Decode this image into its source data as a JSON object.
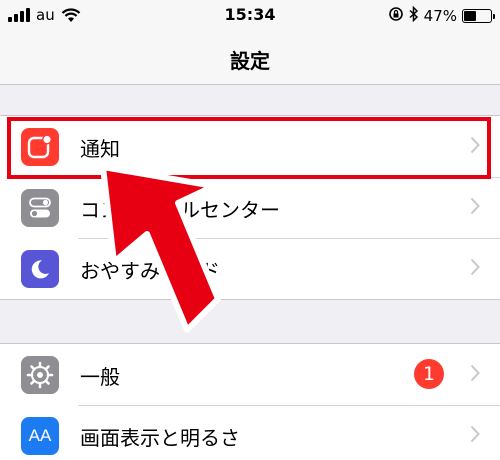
{
  "status_bar": {
    "carrier": "au",
    "time": "15:34",
    "battery_percent": "47%",
    "battery_level": 0.47
  },
  "nav": {
    "title": "設定"
  },
  "groups": [
    {
      "rows": [
        {
          "label": "通知",
          "icon": "notifications-icon",
          "icon_color": "#ff3b30"
        },
        {
          "label": "コントロールセンター",
          "icon": "control-center-icon",
          "icon_color": "#8e8e93"
        },
        {
          "label": "おやすみモード",
          "icon": "moon-icon",
          "icon_color": "#5856d6"
        }
      ]
    },
    {
      "rows": [
        {
          "label": "一般",
          "icon": "gear-icon",
          "icon_color": "#8e8e93",
          "badge": "1"
        },
        {
          "label": "画面表示と明るさ",
          "icon": "text-size-icon",
          "icon_color": "#1c7bf0",
          "icon_text": "AA"
        }
      ]
    }
  ],
  "annotation": {
    "highlight_color": "#e60012",
    "arrow_color": "#e60012"
  }
}
